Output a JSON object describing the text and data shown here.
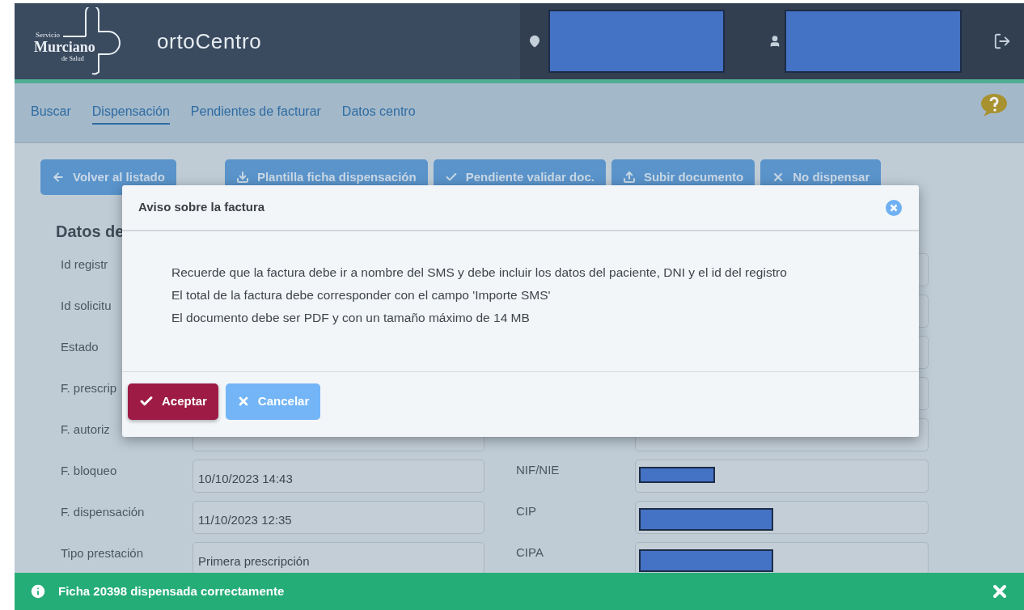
{
  "header": {
    "logo": {
      "line1": "Servicio",
      "line2": "Murciano",
      "line3": "de Salud"
    },
    "app_name": "ortoCentro"
  },
  "nav": [
    {
      "label": "Buscar",
      "selected": false
    },
    {
      "label": "Dispensación",
      "selected": true
    },
    {
      "label": "Pendientes de facturar",
      "selected": false
    },
    {
      "label": "Datos centro",
      "selected": false
    }
  ],
  "toolbar": [
    "Volver al listado",
    "Plantilla ficha dispensación",
    "Pendiente validar doc.",
    "Subir documento",
    "No dispensar"
  ],
  "form": {
    "title": "Datos de",
    "rows": [
      {
        "label": "Id registr"
      },
      {
        "label": "Id solicitu"
      },
      {
        "label": "Estado"
      },
      {
        "label": "F. prescrip"
      },
      {
        "label": "F. autoriz"
      },
      {
        "label": "F. bloqueo",
        "value": "10/10/2023 14:43",
        "right_label": "NIF/NIE",
        "redacted": true
      },
      {
        "label": "F. dispensación",
        "value": "11/10/2023 12:35",
        "right_label": "CIP",
        "redacted": true
      },
      {
        "label": "Tipo prestación",
        "value": "Primera prescripción",
        "right_label": "CIPA",
        "redacted": true
      }
    ]
  },
  "modal": {
    "title": "Aviso sobre la factura",
    "lines": [
      "Recuerde que la factura debe ir a nombre del SMS y debe incluir los datos del paciente, DNI y el id del registro",
      "El total de la factura debe corresponder con el campo 'Importe SMS'",
      "El documento debe ser PDF y con un tamaño máximo de 14 MB"
    ],
    "buttons": [
      {
        "label": "Aceptar",
        "kind": "primary"
      },
      {
        "label": "Cancelar",
        "kind": "secondary"
      }
    ]
  },
  "toast": {
    "text": "Ficha 20398 dispensada correctamente"
  }
}
